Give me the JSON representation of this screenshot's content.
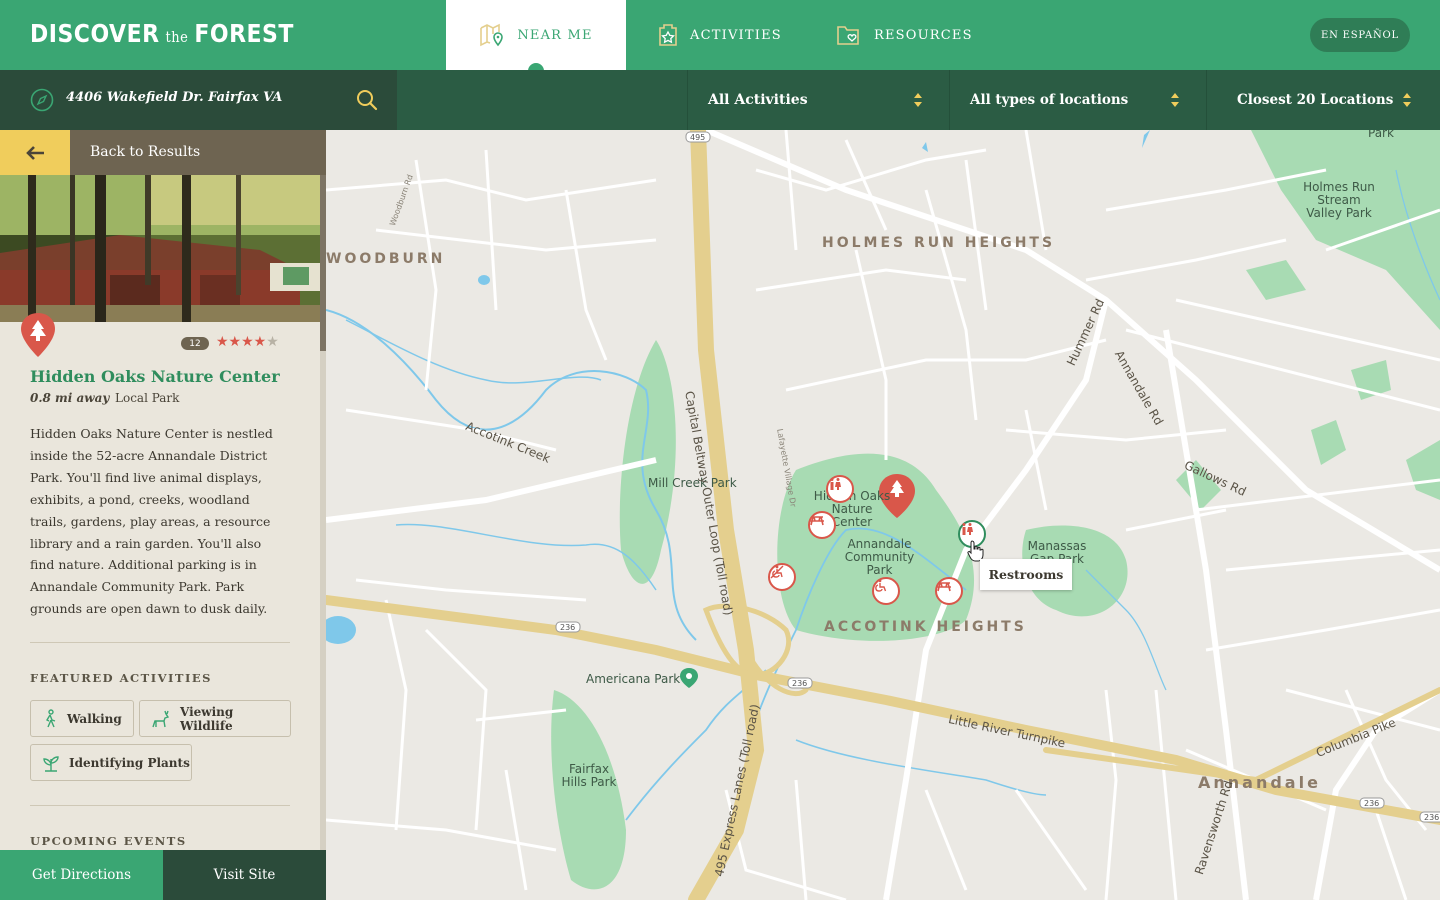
{
  "header": {
    "logo": {
      "main": "DISCOVER",
      "small": "the",
      "end": "FOREST"
    },
    "tabs": [
      {
        "label": "NEAR ME",
        "icon": "map-pin-icon",
        "active": true
      },
      {
        "label": "ACTIVITIES",
        "icon": "badge-star-icon",
        "active": false
      },
      {
        "label": "RESOURCES",
        "icon": "folder-heart-icon",
        "active": false
      }
    ],
    "language_button": "EN ESPAÑOL"
  },
  "filters": {
    "address": "4406 Wakefield Dr. Fairfax VA",
    "activities": "All Activities",
    "location_types": "All types of locations",
    "range": "Closest 20 Locations"
  },
  "sidebar": {
    "back_label": "Back to Results",
    "review_count": "12",
    "rating": 4,
    "rating_max": 5,
    "name": "Hidden Oaks Nature Center",
    "distance": "0.8 mi away",
    "type": "Local Park",
    "description": "Hidden Oaks Nature Center is nestled inside the 52-acre Annandale District Park. You'll find live animal displays, exhibits, a pond, creeks, woodland trails, gardens, play areas, a resource library and a rain garden. You'll also find nature. Additional parking is in Annandale Community Park. Park grounds are open dawn to dusk daily.",
    "featured_title": "FEATURED ACTIVITIES",
    "activities": [
      {
        "label": "Walking",
        "icon": "walking-icon"
      },
      {
        "label": "Viewing Wildlife",
        "icon": "deer-icon"
      },
      {
        "label": "Identifying Plants",
        "icon": "plant-icon"
      }
    ],
    "events_title": "UPCOMING EVENTS",
    "directions_button": "Get Directions",
    "visit_button": "Visit Site"
  },
  "map": {
    "tooltip": "Restrooms",
    "areas": [
      "HOLMES RUN HEIGHTS",
      "WOODBURN",
      "ACCOTINK HEIGHTS",
      "Annandale"
    ],
    "parks": [
      "Mill Creek Park",
      "Hidden Oaks Nature Center",
      "Annandale Community Park",
      "Manassas Gap Park",
      "Americana Park",
      "Fairfax Hills Park",
      "Holmes Run Stream Valley Park",
      "Park"
    ],
    "roads": [
      "Capital Beltway Outer Loop (Toll road)",
      "495 Express Lanes (Toll road)",
      "Little River Turnpike",
      "Columbia Pike",
      "Annandale Rd",
      "Gallows Rd",
      "Hummer Rd",
      "Ravensworth Rd",
      "Accotink Creek",
      "Lafayette Village Dr",
      "Woodburn Rd"
    ],
    "shields": [
      "495",
      "236",
      "236",
      "236",
      "236"
    ],
    "colors": {
      "water": "#7fc8ea",
      "park": "#a8dbb3",
      "highway": "#e4cf8e",
      "marker": "#d9574a"
    }
  }
}
